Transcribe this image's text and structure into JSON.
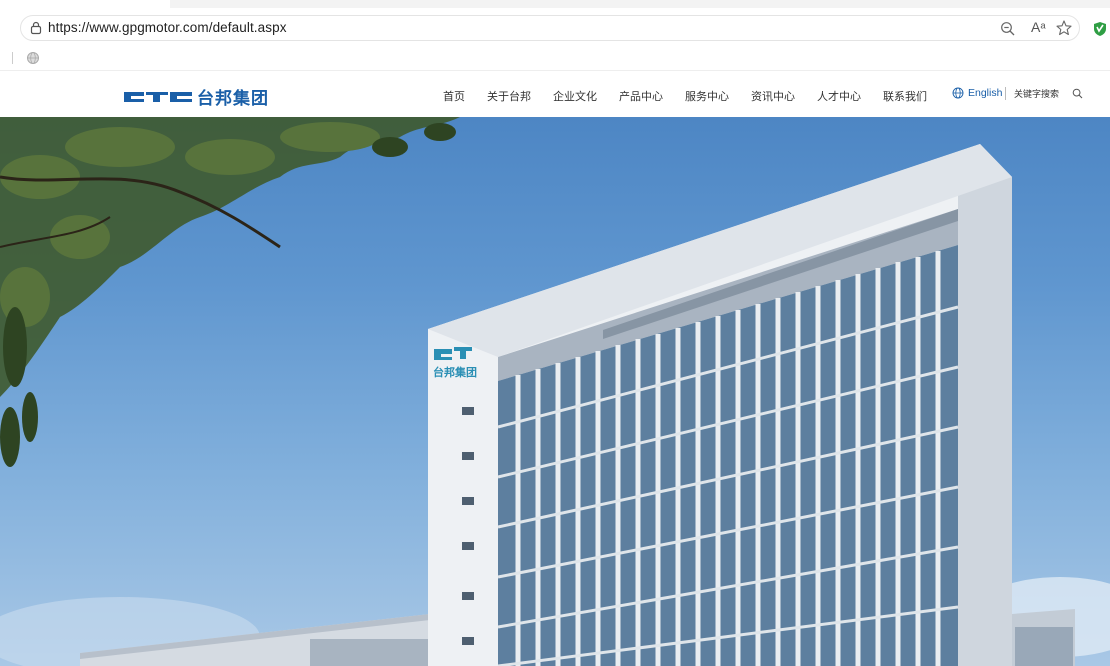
{
  "browser": {
    "url": "https://www.gpgmotor.com/default.aspx",
    "icons": {
      "lock": "lock-icon",
      "zoom": "zoom-out-icon",
      "read_aloud": "read-aloud-icon",
      "favorite": "star-icon",
      "extension": "shield-extension-icon",
      "bookmark": "globe-icon"
    },
    "read_aloud_glyph": "Aᵃ"
  },
  "site": {
    "logo_text": "台邦集团",
    "nav": [
      {
        "label": "首页"
      },
      {
        "label": "关于台邦"
      },
      {
        "label": "企业文化"
      },
      {
        "label": "产品中心"
      },
      {
        "label": "服务中心"
      },
      {
        "label": "资讯中心"
      },
      {
        "label": "人才中心"
      },
      {
        "label": "联系我们"
      }
    ],
    "language": "English",
    "search_placeholder": "关键字搜索",
    "building_sign": "台邦集团",
    "colors": {
      "brand_blue": "#1a5fa8",
      "sign_teal": "#2a8fb4"
    }
  }
}
